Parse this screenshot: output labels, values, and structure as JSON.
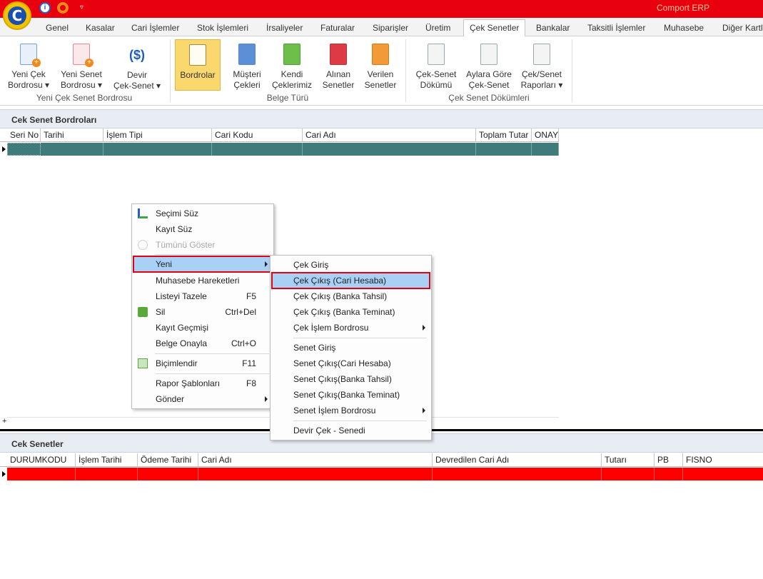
{
  "app": {
    "title": "Comport ERP",
    "logo_letter": "C"
  },
  "tabs": [
    "Genel",
    "Kasalar",
    "Cari İşlemler",
    "Stok İşlemleri",
    "İrsaliyeler",
    "Faturalar",
    "Siparişler",
    "Üretim",
    "Çek Senetler",
    "Bankalar",
    "Taksitli İşlemler",
    "Muhasebe",
    "Diğer Kartla"
  ],
  "active_tab": "Çek Senetler",
  "ribbon": {
    "buttons": [
      {
        "line1": "Yeni Çek",
        "line2": "Bordrosu ▾"
      },
      {
        "line1": "Yeni Senet",
        "line2": "Bordrosu ▾"
      },
      {
        "line1": "Devir",
        "line2": "Çek-Senet ▾"
      },
      {
        "line1": "Bordrolar",
        "line2": ""
      },
      {
        "line1": "Müşteri",
        "line2": "Çekleri"
      },
      {
        "line1": "Kendi",
        "line2": "Çeklerimiz"
      },
      {
        "line1": "Alınan",
        "line2": "Senetler"
      },
      {
        "line1": "Verilen",
        "line2": "Senetler"
      },
      {
        "line1": "Çek-Senet",
        "line2": "Dökümü"
      },
      {
        "line1": "Aylara Göre",
        "line2": "Çek-Senet"
      },
      {
        "line1": "Çek/Senet",
        "line2": "Raporları ▾"
      }
    ],
    "groups": [
      "Yeni Çek Senet Bordrosu",
      "Belge Türü",
      "Çek Senet Dökümleri"
    ],
    "colors": {
      "selected": "#fbd86e",
      "money_icon": "#1e5bc6"
    }
  },
  "top_panel": {
    "title": "Cek Senet Bordroları",
    "columns": [
      "Seri No",
      "Tarihi",
      "İşlem Tipi",
      "Cari Kodu",
      "Cari Adı",
      "Toplam Tutar",
      "ONAY"
    ],
    "row_color": "#3f7b7b",
    "footer_symbol": "+"
  },
  "bottom_panel": {
    "title": "Cek Senetler",
    "columns": [
      "DURUMKODU",
      "İşlem Tarihi",
      "Ödeme Tarihi",
      "Cari Adı",
      "Devredilen Cari Adı",
      "Tutarı",
      "PB",
      "FISNO"
    ],
    "row_color": "#ff0000"
  },
  "context_menu": {
    "items": [
      {
        "label": "Seçimi Süz",
        "shortcut": "",
        "icon": "filter-selection-icon"
      },
      {
        "label": "Kayıt Süz",
        "shortcut": ""
      },
      {
        "label": "Tümünü Göster",
        "shortcut": "",
        "disabled": true,
        "icon": "show-all-icon"
      },
      {
        "label": "Yeni",
        "shortcut": "",
        "submenu": true
      },
      {
        "label": "Muhasebe Hareketleri",
        "shortcut": ""
      },
      {
        "label": "Listeyi Tazele",
        "shortcut": "F5"
      },
      {
        "label": "Sil",
        "shortcut": "Ctrl+Del",
        "icon": "delete-icon"
      },
      {
        "label": "Kayıt Geçmişi",
        "shortcut": ""
      },
      {
        "label": "Belge Onayla",
        "shortcut": "Ctrl+O"
      },
      {
        "label": "Biçimlendir",
        "shortcut": "F11",
        "icon": "format-icon"
      },
      {
        "label": "Rapor Şablonları",
        "shortcut": "F8"
      },
      {
        "label": "Gönder",
        "shortcut": "",
        "submenu": true
      }
    ]
  },
  "submenu": {
    "items": [
      {
        "label": "Çek Giriş"
      },
      {
        "label": "Çek Çıkış (Cari Hesaba)"
      },
      {
        "label": "Çek Çıkış (Banka Tahsil)"
      },
      {
        "label": "Çek Çıkış (Banka Teminat)"
      },
      {
        "label": "Çek İşlem Bordrosu",
        "submenu": true
      },
      {
        "label": "Senet Giriş"
      },
      {
        "label": "Senet Çıkış(Cari Hesaba)"
      },
      {
        "label": "Senet Çıkış(Banka Tahsil)"
      },
      {
        "label": "Senet Çıkış(Banka Teminat)"
      },
      {
        "label": "Senet İşlem Bordrosu",
        "submenu": true
      },
      {
        "label": "Devir Çek - Senedi"
      }
    ],
    "highlight_color": "#a8d1f5",
    "outline_color": "#e00012"
  }
}
